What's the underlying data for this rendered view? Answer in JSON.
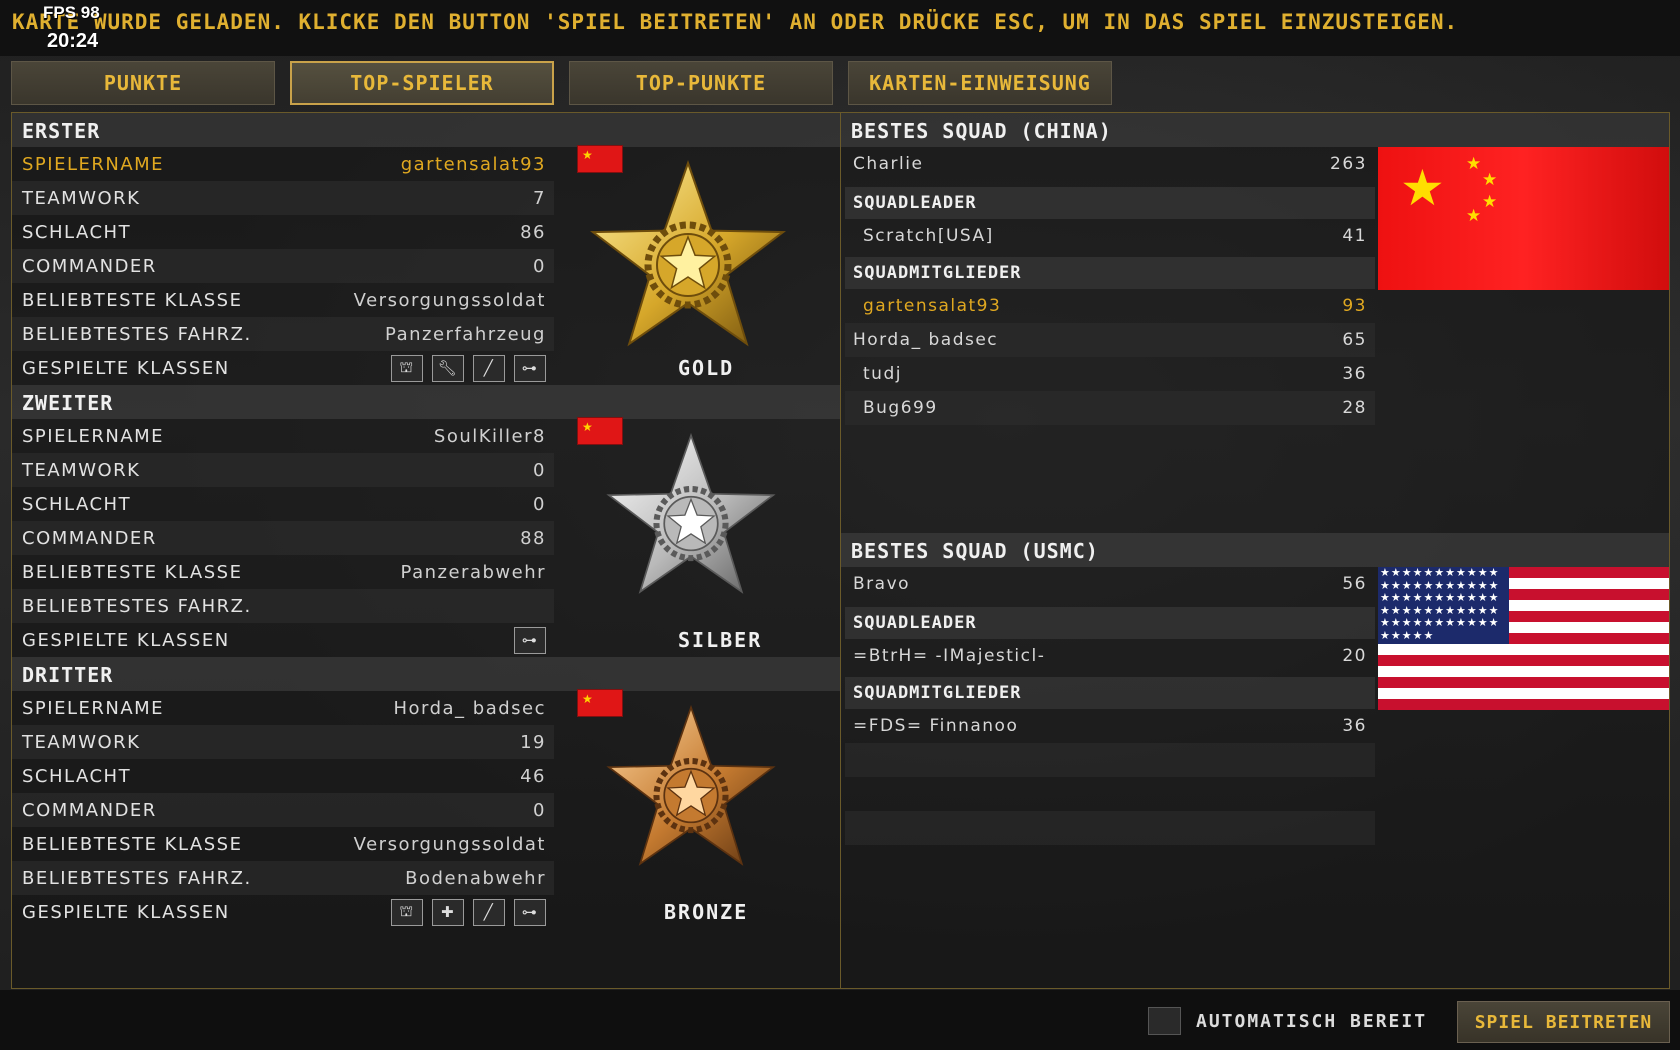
{
  "hud": {
    "fps": "FPS 98",
    "time": "20:24"
  },
  "status_message": "KARTE WURDE GELADEN. KLICKE DEN BUTTON 'SPIEL BEITRETEN' AN ODER DRÜCKE ESC, UM IN DAS SPIEL EINZUSTEIGEN.",
  "tabs": [
    {
      "label": "PUNKTE"
    },
    {
      "label": "TOP-SPIELER",
      "active": true
    },
    {
      "label": "TOP-PUNKTE"
    },
    {
      "label": "KARTEN-EINWEISUNG"
    }
  ],
  "players": [
    {
      "heading": "ERSTER",
      "medal": "GOLD",
      "flag": "china-flag",
      "rows": [
        {
          "label": "SPIELERNAME",
          "value": "gartensalat93"
        },
        {
          "label": "TEAMWORK",
          "value": "7"
        },
        {
          "label": "SCHLACHT",
          "value": "86"
        },
        {
          "label": "COMMANDER",
          "value": "0"
        },
        {
          "label": "BELIEBTESTE KLASSE",
          "value": "Versorgungssoldat"
        },
        {
          "label": "BELIEBTESTES FAHRZ.",
          "value": "Panzerfahrzeug"
        },
        {
          "label": "GESPIELTE KLASSEN",
          "value": ""
        }
      ],
      "class_icons": [
        "engineer-class-icon",
        "wrench-class-icon",
        "assault-rifle-class-icon",
        "antitank-class-icon"
      ]
    },
    {
      "heading": "ZWEITER",
      "medal": "SILBER",
      "flag": "china-flag",
      "rows": [
        {
          "label": "SPIELERNAME",
          "value": "SoulKiller8"
        },
        {
          "label": "TEAMWORK",
          "value": "0"
        },
        {
          "label": "SCHLACHT",
          "value": "0"
        },
        {
          "label": "COMMANDER",
          "value": "88"
        },
        {
          "label": "BELIEBTESTE KLASSE",
          "value": "Panzerabwehr"
        },
        {
          "label": "BELIEBTESTES FAHRZ.",
          "value": ""
        },
        {
          "label": "GESPIELTE KLASSEN",
          "value": ""
        }
      ],
      "class_icons": [
        "antitank-class-icon"
      ]
    },
    {
      "heading": "DRITTER",
      "medal": "BRONZE",
      "flag": "china-flag",
      "rows": [
        {
          "label": "SPIELERNAME",
          "value": "Horda_ badsec"
        },
        {
          "label": "TEAMWORK",
          "value": "19"
        },
        {
          "label": "SCHLACHT",
          "value": "46"
        },
        {
          "label": "COMMANDER",
          "value": "0"
        },
        {
          "label": "BELIEBTESTE KLASSE",
          "value": "Versorgungssoldat"
        },
        {
          "label": "BELIEBTESTES FAHRZ.",
          "value": "Bodenabwehr"
        },
        {
          "label": "GESPIELTE KLASSEN",
          "value": ""
        }
      ],
      "class_icons": [
        "engineer-class-icon",
        "medic-class-icon",
        "assault-rifle-class-icon",
        "antitank-class-icon"
      ]
    }
  ],
  "squads": [
    {
      "heading": "BESTES SQUAD (CHINA)",
      "squad_name": "Charlie",
      "squad_score": "263",
      "leader_heading": "SQUADLEADER",
      "leader": {
        "name": "Scratch[USA]",
        "score": "41"
      },
      "members_heading": "SQUADMITGLIEDER",
      "members": [
        {
          "name": "gartensalat93",
          "score": "93",
          "highlight": true
        },
        {
          "name": "Horda_ badsec",
          "score": "65"
        },
        {
          "name": "tudj",
          "score": "36"
        },
        {
          "name": "Bug699",
          "score": "28"
        }
      ]
    },
    {
      "heading": "BESTES SQUAD (USMC)",
      "squad_name": "Bravo",
      "squad_score": "56",
      "leader_heading": "SQUADLEADER",
      "leader": {
        "name": "=BtrH= -IMajesticl-",
        "score": "20"
      },
      "members_heading": "SQUADMITGLIEDER",
      "members": [
        {
          "name": "=FDS= Finnanoo",
          "score": "36"
        }
      ]
    }
  ],
  "footer": {
    "auto_ready": "AUTOMATISCH BEREIT",
    "join": "SPIEL BEITRETEN"
  },
  "colors": {
    "accent": "#e0a820",
    "tab_text": "#e8b83a",
    "china_red": "#e01616",
    "usa_blue": "#1c2a6b"
  }
}
